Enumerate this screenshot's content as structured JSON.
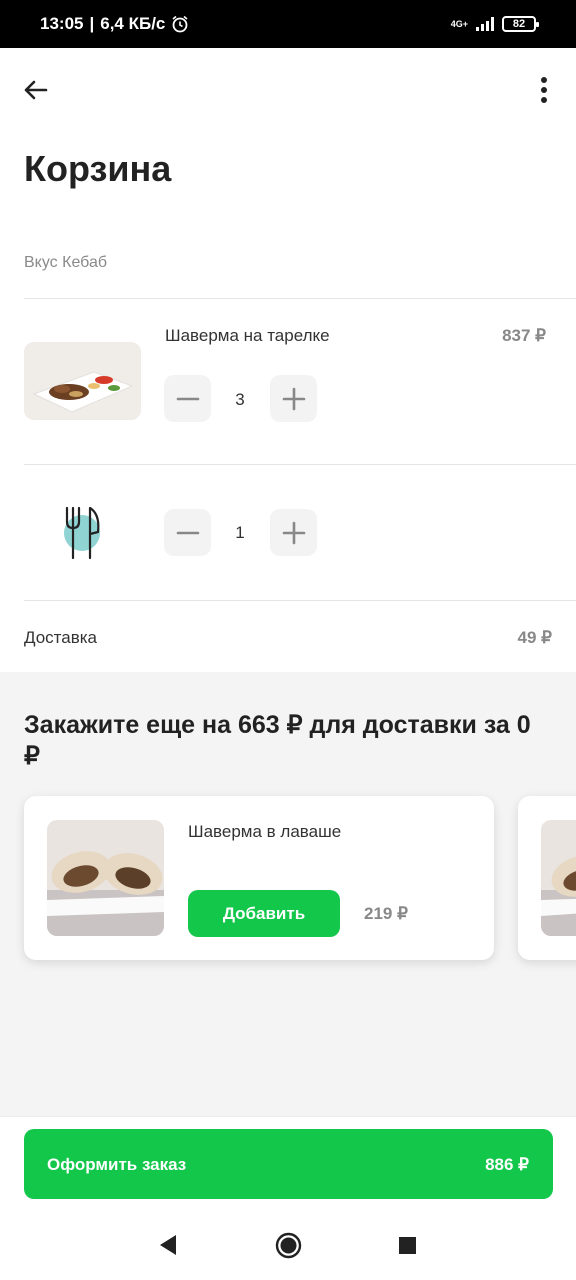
{
  "status_bar": {
    "time": "13:05",
    "separator": "|",
    "speed": "6,4 КБ/с",
    "network": "4G+",
    "battery": "82"
  },
  "header": {
    "back_icon": "arrow-left-icon",
    "menu_icon": "more-vertical-icon"
  },
  "page_title": "Корзина",
  "restaurant_name": "Вкус Кебаб",
  "cart_items": [
    {
      "name": "Шаверма на тарелке",
      "price": "837 ₽",
      "quantity": "3",
      "image": "shawarma-plate-photo"
    },
    {
      "name": "",
      "quantity": "1",
      "image": "cutlery-icon"
    }
  ],
  "delivery": {
    "label": "Доставка",
    "price": "49 ₽"
  },
  "promo": {
    "title": "Закажите еще на 663 ₽ для доставки за 0 ₽",
    "cards": [
      {
        "name": "Шаверма в лаваше",
        "button": "Добавить",
        "price": "219 ₽",
        "image": "shawarma-lavash-photo"
      }
    ]
  },
  "checkout": {
    "label": "Оформить заказ",
    "total": "886 ₽"
  },
  "colors": {
    "accent": "#12c74a",
    "cutlery_bg": "#8fd3d3"
  }
}
